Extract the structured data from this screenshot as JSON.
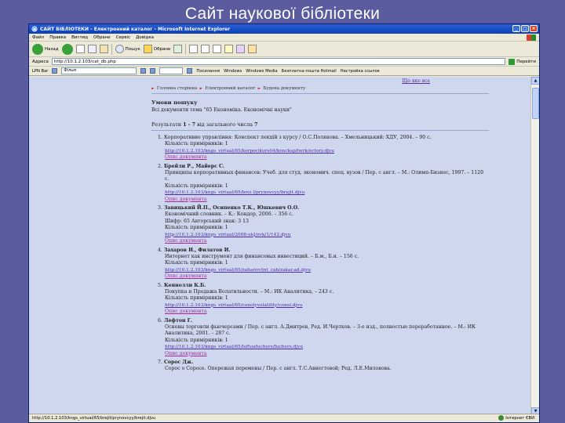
{
  "slide": {
    "title": "Сайт наукової бібліотеки"
  },
  "browser": {
    "window_title": "САЙТ БІБЛІОТЕКИ - Електронний каталог - Microsoft Internet Explorer",
    "menu": [
      "Файл",
      "Правка",
      "Вигляд",
      "Обране",
      "Сервіс",
      "Довідка"
    ],
    "toolbar": {
      "back": "Назад",
      "search": "Пошук",
      "favorites": "Обране"
    },
    "address": {
      "label": "Адреса",
      "value": "http://10.1.2.103/cat_db.php",
      "go": "Перейти"
    },
    "linksbar": {
      "left_label": "LPN Bar",
      "select_value": "Фільм",
      "links": [
        "Посилання",
        "Windows",
        "Windows Media",
        "Безплатна пошта Hotmail",
        "Настройка ссылок"
      ]
    },
    "status": {
      "url": "http://10.1.2.103/kngs_virtual/65/brejit/prynovcyy/brejit.djvu",
      "zone": "Інтернет ЄВИ"
    }
  },
  "page": {
    "top_links": "Що яке все",
    "breadcrumb": [
      "Головна сторінка",
      "Електронний каталог",
      "Будова документу"
    ],
    "condition_title": "Умови пошуку",
    "condition_text": "Всі документи тема \"65 Економіка. Економічні науки\"",
    "results_line": {
      "prefix": "Результати",
      "range": "1 - 7",
      "mid": "від загального числа",
      "total": "7"
    },
    "open_label": "Опис документа",
    "records": [
      {
        "n": "1.",
        "authors": "",
        "text": "Корпоративне управління: Конспект лекцій з курсу / О.С.Полякова. – Хмельницький: ХДУ, 2004. – 90 с.",
        "copies": "Кількість примірників: 1",
        "url": "http://10.1.2.103/kngs_virtual/65/korpor/kurs04/koncksp/lwrk/ectory.djvu"
      },
      {
        "n": "2.",
        "authors": "Брейли Р., Майерс С.",
        "text": "Принципы корпоративных финансов: Учеб. для студ. экономич. спец. вузов / Пер. с англ. – М.: Олимп-Бизнес, 1997. – 1120 с.",
        "copies": "Кількість примірників: 1",
        "url": "http://10.1.2.103/kngs_virtual/65/brei l/prynovcyy/brejit.djvu"
      },
      {
        "n": "3.",
        "authors": "Завицький Й.П., Осипенко Т.К., Юшкевич О.О.",
        "text": "Економічний словник. – К.: Кондор, 2006. – 356 с.",
        "extra": "Шифр: 65     Авторський знак: 3 13",
        "copies": "Кількість примірників: 1",
        "url": "http://10.1.2.103/kngs_virtual/2008-ukJ/zvk/1/142.djvu"
      },
      {
        "n": "4.",
        "authors": "Захаров И., Филатов И.",
        "text": "Интернет как инструмент для финансовых инвестиций. – Б.м., Б.и. – 156 с.",
        "copies": "Кількість примірників: 1",
        "url": "http://10.1.2.103/kngs_virtual/65/zaharov/int_cab/zakar.ad.djvu"
      },
      {
        "n": "5.",
        "authors": "Кеннолли К.Б.",
        "text": "Покупка и Продажа Волатильности. – М.: ИК Аналитика, – 243 с.",
        "copies": "Кількість примірників: 1",
        "url": "http://10.1.2.103/kngs_virtual/65/conolyvolatility/conol.djvu"
      },
      {
        "n": "6.",
        "authors": "Лефтон Г.",
        "text": "Основы торговли фьючерсами / Пер. с англ. А.Дмитрев, Ред. И.Чертков. – 3-е изд., полностью переработанное. – М.: ИК Аналитика, 2001. – 287 с.",
        "copies": "Кількість примірників: 1",
        "url": "http://10.1.2.103/kngs_virtual/65/loftoufuchers/fuchers.djvu"
      },
      {
        "n": "7.",
        "authors": "Сорос Дж.",
        "text": "Сорос о Соросе. Опережая перемены / Пер. с англ. Т.С.Авнегтовой; Ред. Л.Е.Миловова.",
        "copies": "",
        "url": ""
      }
    ]
  }
}
